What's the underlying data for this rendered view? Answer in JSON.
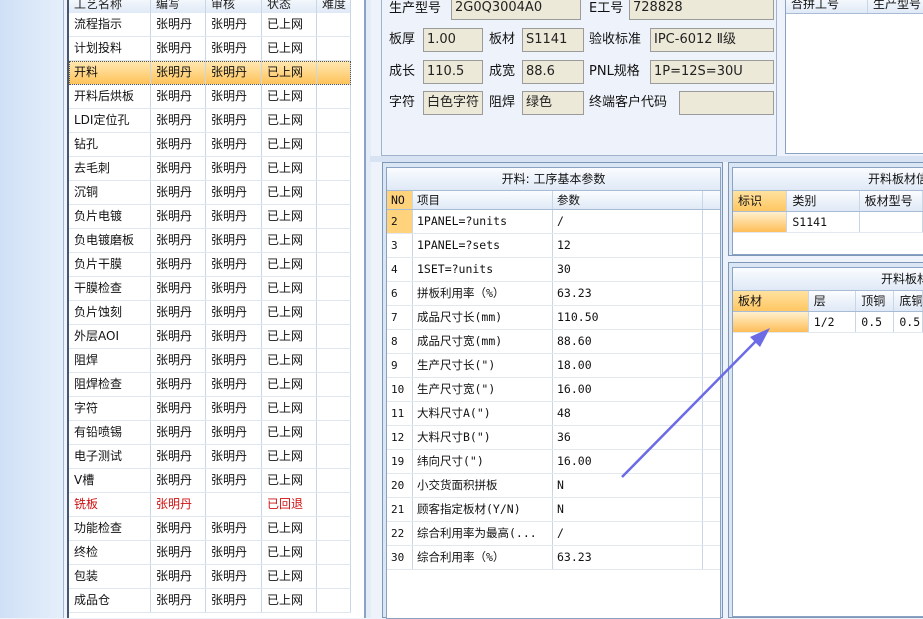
{
  "process_table": {
    "columns": [
      "工艺名称",
      "编写",
      "审核",
      "状态",
      "难度"
    ],
    "rows": [
      [
        "流程指示",
        "张明丹",
        "张明丹",
        "已上网",
        ""
      ],
      [
        "计划投料",
        "张明丹",
        "张明丹",
        "已上网",
        ""
      ],
      [
        "开料",
        "张明丹",
        "张明丹",
        "已上网",
        ""
      ],
      [
        "开料后烘板",
        "张明丹",
        "张明丹",
        "已上网",
        ""
      ],
      [
        "LDI定位孔",
        "张明丹",
        "张明丹",
        "已上网",
        ""
      ],
      [
        "钻孔",
        "张明丹",
        "张明丹",
        "已上网",
        ""
      ],
      [
        "去毛刺",
        "张明丹",
        "张明丹",
        "已上网",
        ""
      ],
      [
        "沉铜",
        "张明丹",
        "张明丹",
        "已上网",
        ""
      ],
      [
        "负片电镀",
        "张明丹",
        "张明丹",
        "已上网",
        ""
      ],
      [
        "负电镀磨板",
        "张明丹",
        "张明丹",
        "已上网",
        ""
      ],
      [
        "负片干膜",
        "张明丹",
        "张明丹",
        "已上网",
        ""
      ],
      [
        "干膜检查",
        "张明丹",
        "张明丹",
        "已上网",
        ""
      ],
      [
        "负片蚀刻",
        "张明丹",
        "张明丹",
        "已上网",
        ""
      ],
      [
        "外层AOI",
        "张明丹",
        "张明丹",
        "已上网",
        ""
      ],
      [
        "阻焊",
        "张明丹",
        "张明丹",
        "已上网",
        ""
      ],
      [
        "阻焊检查",
        "张明丹",
        "张明丹",
        "已上网",
        ""
      ],
      [
        "字符",
        "张明丹",
        "张明丹",
        "已上网",
        ""
      ],
      [
        "有铅喷锡",
        "张明丹",
        "张明丹",
        "已上网",
        ""
      ],
      [
        "电子测试",
        "张明丹",
        "张明丹",
        "已上网",
        ""
      ],
      [
        "V槽",
        "张明丹",
        "张明丹",
        "已上网",
        ""
      ],
      [
        "铣板",
        "张明丹",
        "",
        "已回退",
        ""
      ],
      [
        "功能检查",
        "张明丹",
        "张明丹",
        "已上网",
        ""
      ],
      [
        "终检",
        "张明丹",
        "张明丹",
        "已上网",
        ""
      ],
      [
        "包装",
        "张明丹",
        "张明丹",
        "已上网",
        ""
      ],
      [
        "成品仓",
        "张明丹",
        "张明丹",
        "已上网",
        ""
      ]
    ],
    "selected_index": 2,
    "returned_index": 20,
    "returned_color": "#d01010"
  },
  "form": {
    "production_model_label": "生产型号",
    "production_model_value": "2G0Q3004A0",
    "e_work_no_label": "E工号",
    "e_work_no_value": "728828",
    "board_thickness_label": "板厚",
    "board_thickness_value": "1.00",
    "material_label": "板材",
    "material_value": "S1141",
    "acceptance_label": "验收标准",
    "acceptance_value": "IPC-6012 Ⅱ级",
    "length_label": "成长",
    "length_value": "110.5",
    "width_label": "成宽",
    "width_value": "88.6",
    "pnl_label": "PNL规格",
    "pnl_value": "1P=12S=30U",
    "legend_label": "字符",
    "legend_value": "白色字符",
    "solder_mask_label": "阻焊",
    "solder_mask_value": "绿色",
    "end_customer_label": "终端客户代码",
    "end_customer_value": ""
  },
  "right_top_grid": {
    "columns": [
      "合拼工号",
      "生产型号"
    ]
  },
  "params_panel": {
    "title": "开料: 工序基本参数",
    "columns": [
      "NO",
      "项目",
      "参数"
    ],
    "rows": [
      [
        "2",
        "1PANEL=?units",
        "/"
      ],
      [
        "3",
        "1PANEL=?sets",
        "12"
      ],
      [
        "4",
        "1SET=?units",
        "30"
      ],
      [
        "6",
        "拼板利用率（%）",
        "63.23"
      ],
      [
        "7",
        "成品尺寸长(mm)",
        "110.50"
      ],
      [
        "8",
        "成品尺寸宽(mm)",
        "88.60"
      ],
      [
        "9",
        "生产尺寸长(\")",
        "18.00"
      ],
      [
        "10",
        "生产尺寸宽(\")",
        "16.00"
      ],
      [
        "11",
        "大料尺寸A(\")",
        "48"
      ],
      [
        "12",
        "大料尺寸B(\")",
        "36"
      ],
      [
        "19",
        "纬向尺寸(\")",
        "16.00"
      ],
      [
        "20",
        "小交货面积拼板",
        "N"
      ],
      [
        "21",
        "顾客指定板材(Y/N)",
        "N"
      ],
      [
        "22",
        "综合利用率为最高(...",
        "/"
      ],
      [
        "30",
        "综合利用率（%）",
        "63.23"
      ]
    ]
  },
  "board_panel": {
    "title": "开料板材信",
    "columns": [
      "标识",
      "类别",
      "板材型号"
    ],
    "rows": [
      [
        "",
        "S1141",
        ""
      ]
    ]
  },
  "layer_panel": {
    "title": "开料板材",
    "columns": [
      "板材",
      "层",
      "顶铜",
      "底铜"
    ],
    "rows": [
      [
        "",
        "1/2",
        "0.5",
        "0.5"
      ]
    ]
  },
  "colors": {
    "selection": "#ffc35a",
    "arrow": "#6b6be6"
  }
}
